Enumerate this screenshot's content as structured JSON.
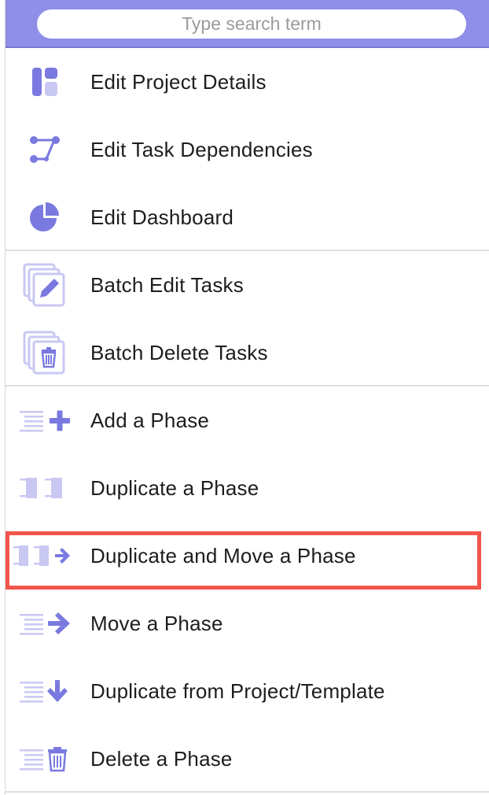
{
  "search": {
    "placeholder": "Type search term"
  },
  "menu": {
    "items": [
      {
        "label": "Edit Project Details",
        "icon": "project-details-icon"
      },
      {
        "label": "Edit Task Dependencies",
        "icon": "task-dependencies-icon"
      },
      {
        "label": "Edit Dashboard",
        "icon": "pie-chart-icon"
      },
      {
        "label": "Batch Edit Tasks",
        "icon": "batch-edit-icon"
      },
      {
        "label": "Batch Delete Tasks",
        "icon": "batch-delete-icon"
      },
      {
        "label": "Add a Phase",
        "icon": "add-phase-icon"
      },
      {
        "label": "Duplicate a Phase",
        "icon": "duplicate-phase-icon"
      },
      {
        "label": "Duplicate and Move a Phase",
        "icon": "duplicate-move-phase-icon"
      },
      {
        "label": "Move a Phase",
        "icon": "move-phase-icon"
      },
      {
        "label": "Duplicate from Project/Template",
        "icon": "duplicate-from-template-icon"
      },
      {
        "label": "Delete a Phase",
        "icon": "delete-phase-icon"
      }
    ]
  },
  "colors": {
    "accent": "#8f8ee8",
    "icon": "#7a79e0",
    "icon_light": "#c9c8f3",
    "highlight_border": "#f2554c"
  }
}
